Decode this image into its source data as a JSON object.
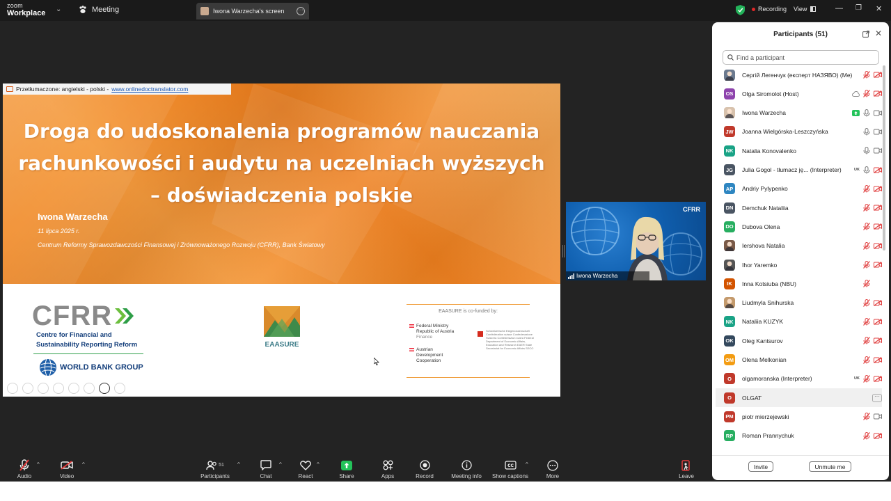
{
  "app": {
    "brand_top": "zoom",
    "brand_bottom": "Workplace"
  },
  "tabs": {
    "meeting": "Meeting",
    "screen": "Iwona Warzecha's screen"
  },
  "status": {
    "recording": "Recording",
    "view": "View"
  },
  "slide": {
    "translation_prefix": "Przetłumaczone: angielski - polski - ",
    "translation_link": "www.onlinedoctranslator.com",
    "title": "Droga do udoskonalenia programów nauczania rachunkowości i audytu na uczelniach wyższych – doświadczenia polskie",
    "author": "Iwona Warzecha",
    "date": "11 lipca 2025 r.",
    "organization": "Centrum Reformy Sprawozdawczości Finansowej i Zrównoważonego Rozwoju (CFRR), Bank Światowy",
    "logos": {
      "cfrr": "CFRR",
      "cfrr_line1": "Centre for Financial and",
      "cfrr_line2": "Sustainability Reporting Reform",
      "wbg": "WORLD BANK GROUP",
      "eaasure": "EAASURE",
      "cofunded": "EAASURE is co-funded by:",
      "austria_ministry_1": "Federal Ministry",
      "austria_ministry_2": "Republic of Austria",
      "austria_ministry_3": "Finance",
      "austria_adc_1": "Austrian",
      "austria_adc_2": "Development",
      "austria_adc_3": "Cooperation",
      "swiss": "Schweizerische Eidgenossenschaft Confédération suisse Confederazione Svizzera Confederaziun svizra Federal Department of Economic Affairs, Education and Research EAER State Secretariat for Economic Affairs SECO"
    }
  },
  "video": {
    "name": "Iwona Warzecha",
    "logo": "CFRR"
  },
  "toolbar": {
    "audio": "Audio",
    "video": "Video",
    "participants": "Participants",
    "participants_count": "51",
    "chat": "Chat",
    "react": "React",
    "share": "Share",
    "apps": "Apps",
    "record": "Record",
    "meeting_info": "Meeting info",
    "captions": "Show captions",
    "more": "More",
    "leave": "Leave"
  },
  "panel": {
    "title": "Participants (51)",
    "search_placeholder": "Find a participant",
    "invite": "Invite",
    "unmute": "Unmute me",
    "participants": [
      {
        "initials": "",
        "name": "Сергій Легенчук (експерт НАЗЯВО) (Me)",
        "color": "#6b7a8f",
        "photo": true,
        "tag": "",
        "mic": "muted",
        "cam": "off",
        "extra": ""
      },
      {
        "initials": "OS",
        "name": "Olga Siromolot (Host)",
        "color": "#8e44ad",
        "photo": false,
        "tag": "",
        "mic": "muted",
        "cam": "off",
        "extra": "cloud"
      },
      {
        "initials": "",
        "name": "Iwona Warzecha",
        "color": "#d8c2ad",
        "photo": true,
        "tag": "",
        "mic": "on",
        "cam": "on",
        "extra": "share"
      },
      {
        "initials": "JW",
        "name": "Joanna Wielgórska-Leszczyńska",
        "color": "#c0392b",
        "photo": false,
        "tag": "",
        "mic": "on",
        "cam": "on",
        "extra": ""
      },
      {
        "initials": "NK",
        "name": "Natalia Konovalenko",
        "color": "#1aa386",
        "photo": false,
        "tag": "",
        "mic": "on",
        "cam": "on",
        "extra": ""
      },
      {
        "initials": "JG",
        "name": "Julia Gogol - tłumacz ję... (Interpreter)",
        "color": "#4a5563",
        "photo": false,
        "tag": "UK",
        "mic": "on",
        "cam": "off",
        "extra": ""
      },
      {
        "initials": "AP",
        "name": "Andriy Pylypenko",
        "color": "#2e86c1",
        "photo": false,
        "tag": "",
        "mic": "muted",
        "cam": "off",
        "extra": ""
      },
      {
        "initials": "DN",
        "name": "Demchuk Nataliia",
        "color": "#4a5563",
        "photo": false,
        "tag": "",
        "mic": "muted",
        "cam": "off",
        "extra": ""
      },
      {
        "initials": "DO",
        "name": "Dubova Olena",
        "color": "#27ae60",
        "photo": false,
        "tag": "",
        "mic": "muted",
        "cam": "off",
        "extra": ""
      },
      {
        "initials": "",
        "name": "Iershova Natalia",
        "color": "#7a5a48",
        "photo": true,
        "tag": "",
        "mic": "muted",
        "cam": "off",
        "extra": ""
      },
      {
        "initials": "",
        "name": "Ihor Yaremko",
        "color": "#555555",
        "photo": true,
        "tag": "",
        "mic": "muted",
        "cam": "off",
        "extra": ""
      },
      {
        "initials": "IK",
        "name": "Inna Kotsiuba (NBU)",
        "color": "#d35400",
        "photo": false,
        "tag": "",
        "mic": "muted",
        "cam": "none",
        "extra": ""
      },
      {
        "initials": "",
        "name": "Liudmyla Snihurska",
        "color": "#c49a6c",
        "photo": true,
        "tag": "",
        "mic": "muted",
        "cam": "off",
        "extra": ""
      },
      {
        "initials": "NK",
        "name": "Nataliia KUZYK",
        "color": "#1aa386",
        "photo": false,
        "tag": "",
        "mic": "muted",
        "cam": "off",
        "extra": ""
      },
      {
        "initials": "OK",
        "name": "Oleg Kantsurov",
        "color": "#34495e",
        "photo": false,
        "tag": "",
        "mic": "muted",
        "cam": "off",
        "extra": ""
      },
      {
        "initials": "OM",
        "name": "Olena Melkonian",
        "color": "#f39c12",
        "photo": false,
        "tag": "",
        "mic": "muted",
        "cam": "off",
        "extra": ""
      },
      {
        "initials": "O",
        "name": "olgamoranska (Interpreter)",
        "color": "#c0392b",
        "photo": false,
        "tag": "UK",
        "mic": "muted",
        "cam": "off",
        "extra": ""
      },
      {
        "initials": "O",
        "name": "OLGAT",
        "color": "#c0392b",
        "photo": false,
        "tag": "",
        "mic": "more",
        "cam": "none",
        "extra": ""
      },
      {
        "initials": "PM",
        "name": "piotr mierzejewski",
        "color": "#c0392b",
        "photo": false,
        "tag": "",
        "mic": "muted",
        "cam": "on",
        "extra": ""
      },
      {
        "initials": "RP",
        "name": "Roman Prannychuk",
        "color": "#27ae60",
        "photo": false,
        "tag": "",
        "mic": "muted",
        "cam": "off",
        "extra": ""
      }
    ]
  }
}
